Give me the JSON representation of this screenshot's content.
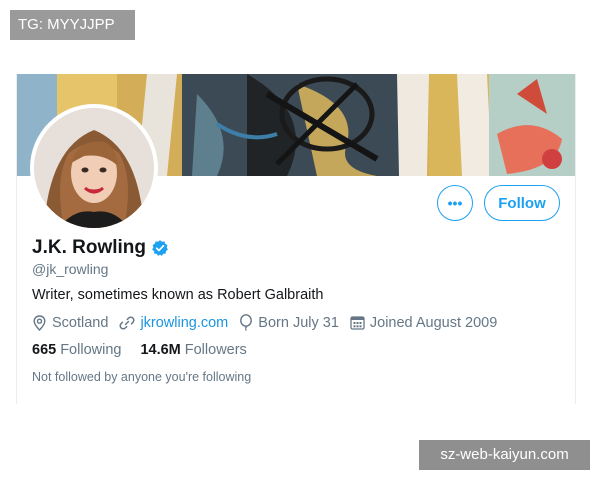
{
  "watermarks": {
    "top": "TG: MYYJJPP",
    "bottom": "sz-web-kaiyun.com"
  },
  "profile": {
    "display_name": "J.K. Rowling",
    "handle": "@jk_rowling",
    "bio": "Writer, sometimes known as Robert Galbraith",
    "location": "Scotland",
    "website": "jkrowling.com",
    "birthday": "Born July 31",
    "joined": "Joined August 2009",
    "verified": true
  },
  "stats": {
    "following_count": "665",
    "following_label": "Following",
    "followers_count": "14.6M",
    "followers_label": "Followers"
  },
  "social_context": "Not followed by anyone you're following",
  "actions": {
    "more_label": "•••",
    "follow_label": "Follow"
  },
  "colors": {
    "accent": "#1da1f2",
    "link": "#1b95e0",
    "muted": "#657786",
    "text": "#14171a"
  },
  "icons": [
    "location-pin-icon",
    "link-icon",
    "balloon-icon",
    "calendar-icon",
    "verified-badge-icon",
    "more-icon"
  ]
}
